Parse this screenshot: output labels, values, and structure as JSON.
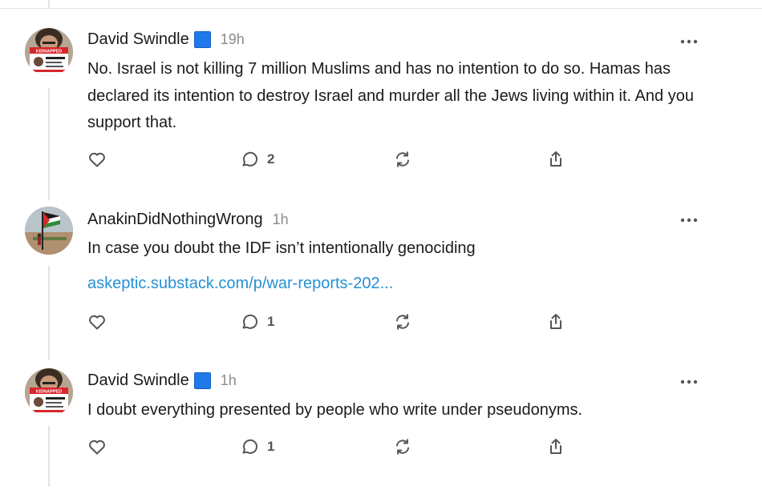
{
  "comments": [
    {
      "author": "David Swindle",
      "verified_badge_color": "#1f79e8",
      "time": "19h",
      "text": "No. Israel is not killing 7 million Muslims and has no intention to do so. Hamas has declared its intention to destroy Israel and murder all the Jews living within it. And you support that.",
      "avatar_sign_text": "KIDNAPPED",
      "reply_count": "2"
    },
    {
      "author": "AnakinDidNothingWrong",
      "time": "1h",
      "text": "In case you doubt the IDF isn’t intentionally genociding",
      "link": "askeptic.substack.com/p/war-reports-202...",
      "reply_count": "1"
    },
    {
      "author": "David Swindle",
      "verified_badge_color": "#1f79e8",
      "time": "1h",
      "text": "I doubt everything presented by people who write under pseudonyms.",
      "avatar_sign_text": "KIDNAPPED",
      "reply_count": "1"
    }
  ],
  "icons": {
    "like": "heart-icon",
    "reply": "comment-bubble-icon",
    "restack": "restack-icon",
    "share": "share-upload-icon",
    "more": "more-dots-icon"
  },
  "colors": {
    "link": "#2590d4",
    "muted": "#8c8c8c",
    "thread_line": "#e3e3e3"
  }
}
